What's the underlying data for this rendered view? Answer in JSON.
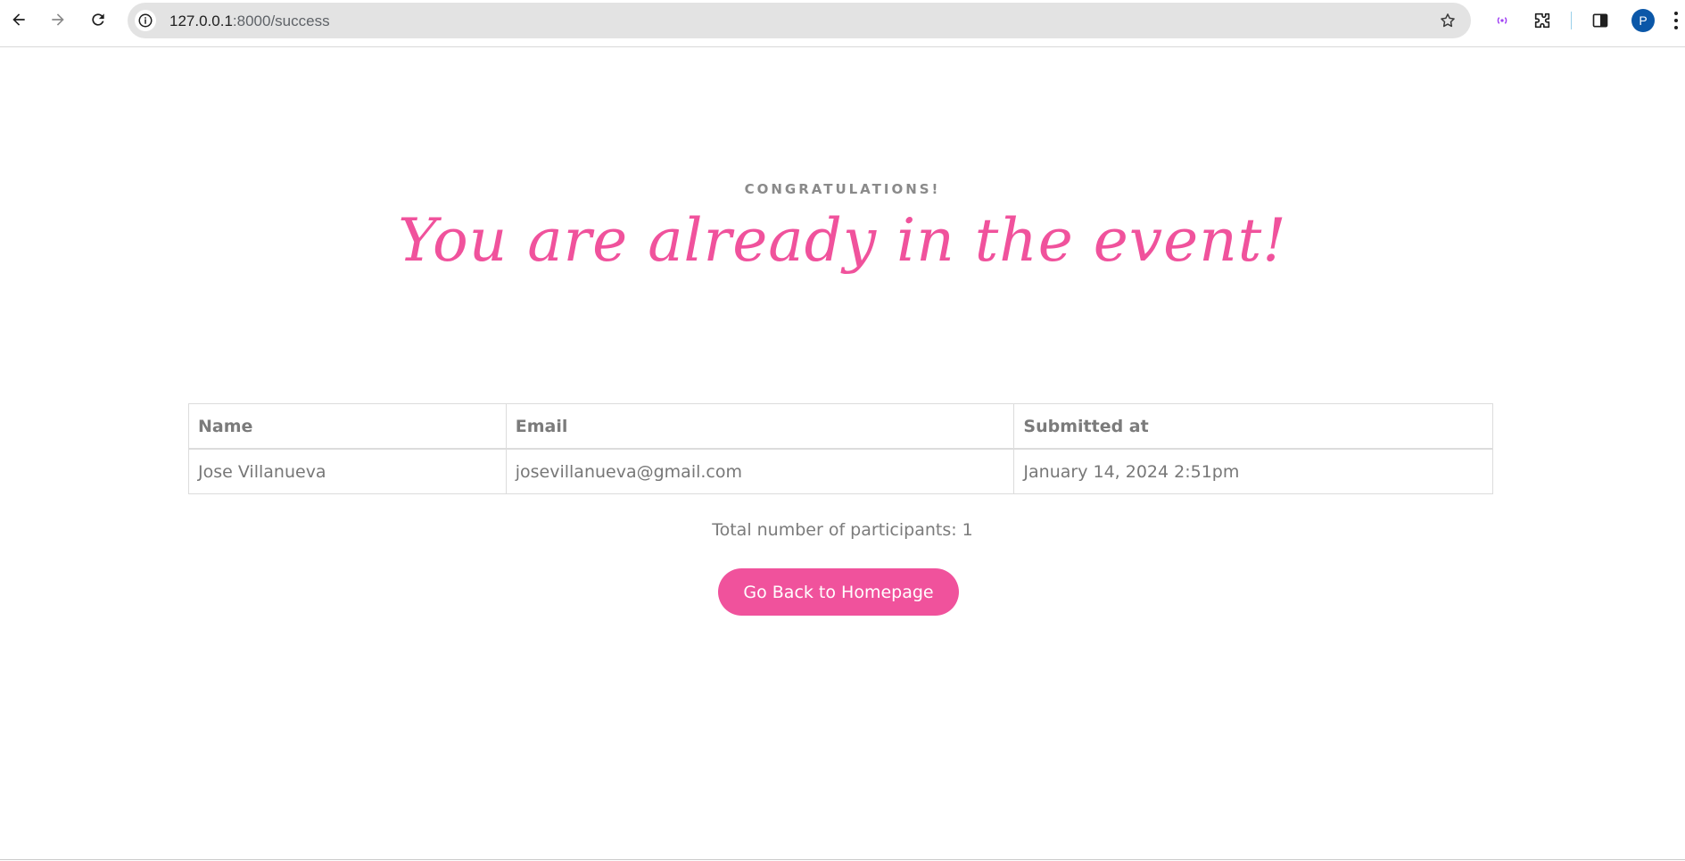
{
  "browser": {
    "url_host": "127.0.0.1",
    "url_rest": ":8000/success",
    "profile_initial": "P"
  },
  "page": {
    "eyebrow": "CONGRATULATIONS!",
    "headline": "You are already in the event!",
    "table": {
      "headers": [
        "Name",
        "Email",
        "Submitted at"
      ],
      "rows": [
        [
          "Jose Villanueva",
          "josevillanueva@gmail.com",
          "January 14, 2024 2:51pm"
        ]
      ]
    },
    "total_text": "Total number of participants: 1",
    "home_button_label": "Go Back to Homepage"
  },
  "colors": {
    "accent_pink": "#f0529c",
    "muted_text": "#7b7b7b",
    "avatar_blue": "#0b57a8"
  }
}
